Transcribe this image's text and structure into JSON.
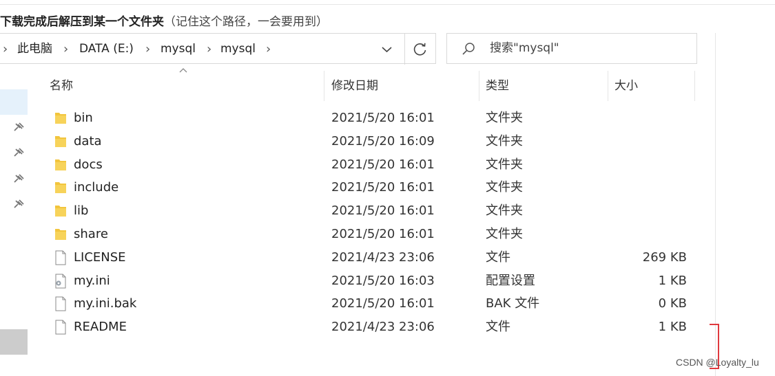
{
  "note": {
    "bold": "下载完成后解压到某一个文件夹",
    "light": "（记住这个路径，一会要用到）"
  },
  "breadcrumb": [
    "此电脑",
    "DATA (E:)",
    "mysql",
    "mysql"
  ],
  "search": {
    "placeholder": "搜索\"mysql\""
  },
  "columns": {
    "name": "名称",
    "date": "修改日期",
    "type": "类型",
    "size": "大小"
  },
  "files": [
    {
      "name": "bin",
      "date": "2021/5/20 16:01",
      "type": "文件夹",
      "size": "",
      "icon": "folder-icon"
    },
    {
      "name": "data",
      "date": "2021/5/20 16:09",
      "type": "文件夹",
      "size": "",
      "icon": "folder-icon"
    },
    {
      "name": "docs",
      "date": "2021/5/20 16:01",
      "type": "文件夹",
      "size": "",
      "icon": "folder-icon"
    },
    {
      "name": "include",
      "date": "2021/5/20 16:01",
      "type": "文件夹",
      "size": "",
      "icon": "folder-icon"
    },
    {
      "name": "lib",
      "date": "2021/5/20 16:01",
      "type": "文件夹",
      "size": "",
      "icon": "folder-icon"
    },
    {
      "name": "share",
      "date": "2021/5/20 16:01",
      "type": "文件夹",
      "size": "",
      "icon": "folder-icon"
    },
    {
      "name": "LICENSE",
      "date": "2021/4/23 23:06",
      "type": "文件",
      "size": "269 KB",
      "icon": "file-icon"
    },
    {
      "name": "my.ini",
      "date": "2021/5/20 16:03",
      "type": "配置设置",
      "size": "1 KB",
      "icon": "settings-file-icon"
    },
    {
      "name": "my.ini.bak",
      "date": "2021/5/20 16:01",
      "type": "BAK 文件",
      "size": "0 KB",
      "icon": "file-icon"
    },
    {
      "name": "README",
      "date": "2021/4/23 23:06",
      "type": "文件",
      "size": "1 KB",
      "icon": "file-icon"
    }
  ],
  "watermark": "CSDN @Loyalty_lu",
  "colors": {
    "folder": "#f2c53d",
    "selection": "#e5f1fb",
    "annotation": "#e0393e"
  }
}
